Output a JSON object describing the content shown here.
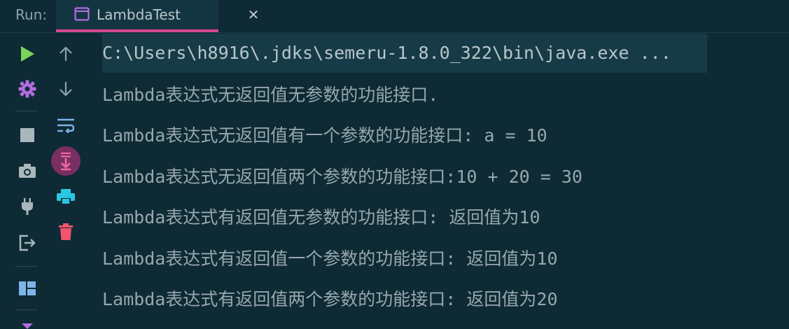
{
  "run_bar": {
    "label": "Run:",
    "tab_label": "LambdaTest",
    "close_glyph": "✕"
  },
  "toolbar": {
    "left_icons": [
      "run-icon",
      "settings-icon",
      "stop-icon",
      "camera-icon",
      "plug-icon",
      "exit-icon",
      "layout-icon"
    ],
    "right_icons": [
      "up-arrow-icon",
      "down-arrow-icon",
      "soft-wrap-icon",
      "scroll-to-end-icon",
      "print-icon",
      "trash-icon"
    ]
  },
  "colors": {
    "background": "#0e2a35",
    "accent_tab": "#d6458f",
    "run_green": "#7ad45a",
    "settings_purple": "#b36ee0",
    "scroll_btn_bg": "#7a2f62",
    "print_cyan": "#29c7e3",
    "trash_red": "#f2546c"
  },
  "console": {
    "command": "C:\\Users\\h8916\\.jdks\\semeru-1.8.0_322\\bin\\java.exe ...",
    "lines": [
      "Lambda表达式无返回值无参数的功能接口.",
      "Lambda表达式无返回值有一个参数的功能接口: a = 10",
      "Lambda表达式无返回值两个参数的功能接口:10 + 20 = 30",
      "Lambda表达式有返回值无参数的功能接口: 返回值为10",
      "Lambda表达式有返回值一个参数的功能接口: 返回值为10",
      "Lambda表达式有返回值两个参数的功能接口: 返回值为20"
    ]
  }
}
